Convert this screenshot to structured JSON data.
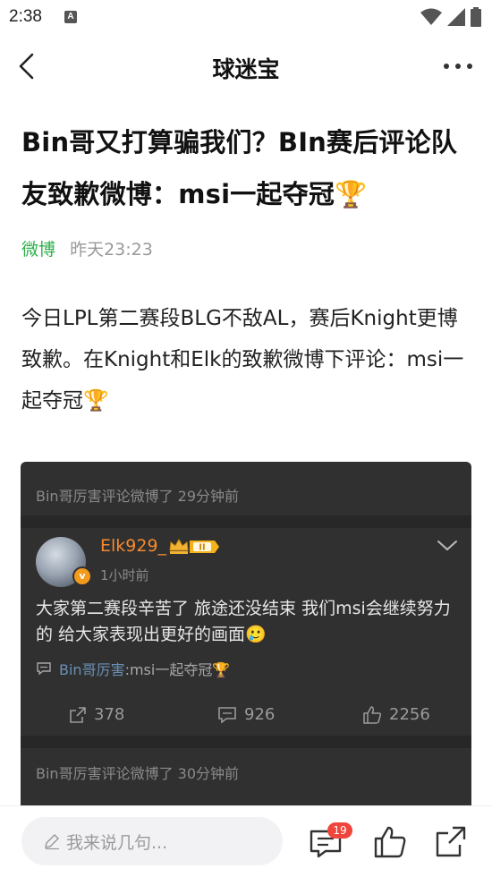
{
  "status_bar": {
    "time": "2:38",
    "notification_badge": "A"
  },
  "nav": {
    "title": "球迷宝"
  },
  "article": {
    "title": "Bin哥又打算骗我们？BIn赛后评论队友致歉微博：msi一起夺冠🏆",
    "source": "微博",
    "time": "昨天23:23",
    "body": "今日LPL第二赛段BLG不敌AL，赛后Knight更博致歉。在Knight和Elk的致歉微博下评论：msi一起夺冠🏆"
  },
  "embed": {
    "comment_header": "Bin哥厉害评论微博了 29分钟前",
    "post": {
      "username": "Elk929_",
      "level_badge": "II",
      "avatar_badge": "v",
      "posted_ago": "1小时前",
      "content": "大家第二赛段辛苦了 旅途还没结束 我们msi会继续努力的 给大家表现出更好的画面🥲",
      "quote_author": "Bin哥厉害",
      "quote_text": ":msi一起夺冠🏆",
      "reposts": "378",
      "comments": "926",
      "likes": "2256"
    },
    "next_comment_header": "Bin哥厉害评论微博了 30分钟前"
  },
  "bottom_bar": {
    "input_placeholder": "我来说几句...",
    "comment_count": "19"
  },
  "colors": {
    "source_green": "#2cb04a",
    "username_orange": "#f58a2e",
    "badge_red": "#f0453a",
    "embed_bg": "#303030"
  }
}
